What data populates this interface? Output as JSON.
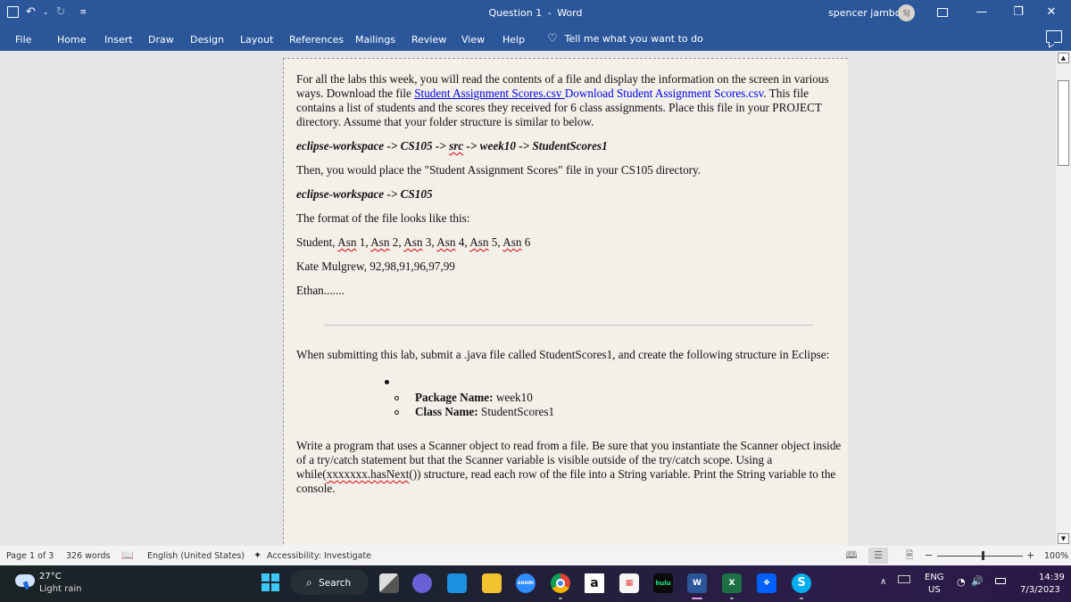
{
  "titlebar": {
    "title": "Question 1",
    "separator": "-",
    "app": "Word",
    "user_name": "spencer jambo",
    "user_initials": "SJ",
    "qat": {
      "save_icon": "save-icon",
      "undo_icon": "undo-icon",
      "redo_icon": "redo-icon",
      "customize_icon": "customize-icon"
    },
    "window_buttons": {
      "ribbon_display": "⬚",
      "minimize": "—",
      "restore": "❐",
      "close": "✕"
    }
  },
  "ribbon": {
    "tabs": [
      "File",
      "Home",
      "Insert",
      "Draw",
      "Design",
      "Layout",
      "References",
      "Mailings",
      "Review",
      "View",
      "Help"
    ],
    "tell_me": "Tell me what you want to do"
  },
  "document": {
    "intro": {
      "text1": "For all the labs this week, you will read the contents of a file and display the information on the screen in various ways. Download the file ",
      "link1": "Student Assignment Scores.csv ",
      "link2": "Download Student Assignment Scores.csv",
      "text2": ". This file contains a list of students and the scores they received for 6 class assignments. Place this file in your PROJECT directory.  Assume that your folder structure is similar to below."
    },
    "path1": {
      "a": "eclipse-workspace -> CS105 -> ",
      "b": "src",
      "c": " -> week10 -> StudentScores1"
    },
    "then_text": "Then, you would place the \"Student Assignment Scores\" file in your CS105 directory.",
    "path2": "eclipse-workspace -> CS105",
    "format_text": "The format of the file looks like this:",
    "header_line": {
      "student": "Student, ",
      "asn": "Asn",
      "items": [
        " 1, ",
        " 2, ",
        " 3, ",
        " 4, ",
        " 5, ",
        " 6"
      ]
    },
    "sample_line": "Kate Mulgrew, 92,98,91,96,97,99",
    "ethan_line": "Ethan.......",
    "submit_text": "When submitting this lab, submit a .java file called StudentScores1, and create the following structure in Eclipse:",
    "list": [
      {
        "label": "Package Name:",
        "value": " week10"
      },
      {
        "label": "Class Name:",
        "value": " StudentScores1"
      }
    ],
    "write": {
      "a": "Write a program that uses a Scanner object to read from a file. Be sure that you instantiate the Scanner object inside of a try/catch statement but that the Scanner variable is visible outside of the try/catch scope. Using a while(",
      "b": "xxxxxxx.hasNext",
      "c": "()) structure, read each row of the file into a String variable. Print the String variable to the console."
    }
  },
  "statusbar": {
    "page": "Page 1 of 3",
    "words": "326 words",
    "language": "English (United States)",
    "accessibility": "Accessibility: Investigate",
    "zoom_minus": "−",
    "zoom_plus": "+",
    "zoom": "100%",
    "zoom_level_percent": 100
  },
  "taskbar": {
    "temperature": "27°C",
    "condition": "Light rain",
    "search": "Search",
    "apps": [
      {
        "name": "task-view",
        "label": ""
      },
      {
        "name": "teams",
        "label": ""
      },
      {
        "name": "mail",
        "label": ""
      },
      {
        "name": "file-explorer",
        "label": ""
      },
      {
        "name": "zoom",
        "label": "zoom"
      },
      {
        "name": "chrome",
        "label": ""
      },
      {
        "name": "amazon",
        "label": "a"
      },
      {
        "name": "microsoft-store",
        "label": ""
      },
      {
        "name": "hulu",
        "label": "hulu"
      },
      {
        "name": "word",
        "label": "W"
      },
      {
        "name": "excel",
        "label": "X"
      },
      {
        "name": "dropbox",
        "label": ""
      },
      {
        "name": "skype",
        "label": "S"
      }
    ],
    "lang_top": "ENG",
    "lang_bottom": "US",
    "time": "14:39",
    "date": "7/3/2023"
  }
}
